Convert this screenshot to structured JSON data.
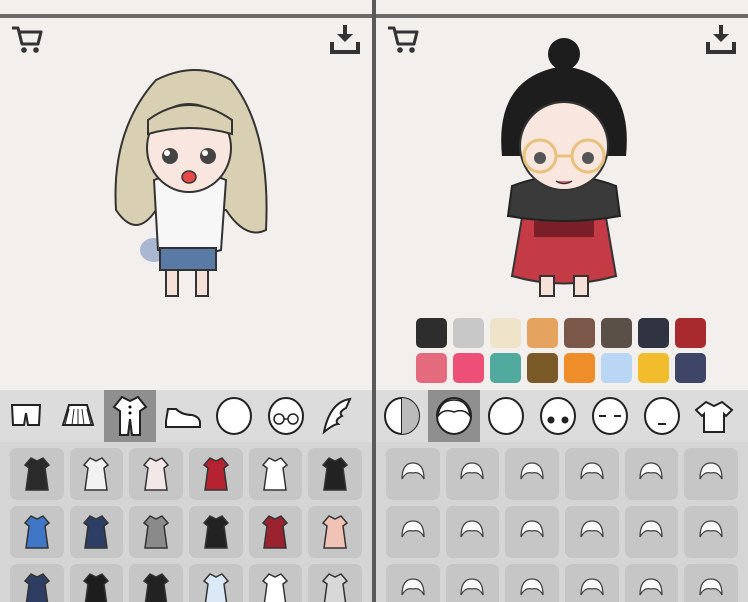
{
  "left_panel": {
    "tabs": [
      "shorts-icon",
      "skirt-icon",
      "jumpsuit-icon",
      "shoe-icon",
      "face-icon",
      "glasses-icon",
      "wing-icon"
    ],
    "selected_tab": 2,
    "items": [
      {
        "name": "black-dress-icon",
        "color": "#2a2a2a"
      },
      {
        "name": "white-dress-icon",
        "color": "#f2f2f2"
      },
      {
        "name": "pink-dress-icon",
        "color": "#f3e7e7"
      },
      {
        "name": "red-dress-icon",
        "color": "#b4232f"
      },
      {
        "name": "sailor-dress-icon",
        "color": "#ffffff"
      },
      {
        "name": "black-apron-dress-icon",
        "color": "#222222"
      },
      {
        "name": "blue-kimono-icon",
        "color": "#3f76c5"
      },
      {
        "name": "navy-tshirt-icon",
        "color": "#2e3d64"
      },
      {
        "name": "gray-apron-dress-icon",
        "color": "#8a8a8a"
      },
      {
        "name": "black-jumpsuit-icon",
        "color": "#222222"
      },
      {
        "name": "maroon-dress-icon",
        "color": "#9b2330"
      },
      {
        "name": "peach-coat-icon",
        "color": "#f1c2b6"
      },
      {
        "name": "navy-coat-icon",
        "color": "#2e3d64"
      },
      {
        "name": "black-white-dress-icon",
        "color": "#1d1d1d"
      },
      {
        "name": "black-offshoulder-icon",
        "color": "#222222"
      },
      {
        "name": "blue-print-dress-icon",
        "color": "#dbe8f5"
      },
      {
        "name": "white-dress2-icon",
        "color": "#ffffff"
      },
      {
        "name": "gray-coat-icon",
        "color": "#d8d8d8"
      }
    ]
  },
  "right_panel": {
    "palette": [
      "#2d2d2d",
      "#c8c8c8",
      "#efe3c9",
      "#e4a35e",
      "#7a5748",
      "#5b5048",
      "#2f3440",
      "#a82a2e",
      "#e46b7e",
      "#ec4f78",
      "#50a99c",
      "#7a5a26",
      "#ef8e28",
      "#b9d6f2",
      "#f2bc2c",
      "#3e4567"
    ],
    "tabs": [
      "half-face-icon",
      "hair-icon",
      "head-icon",
      "eyes-icon",
      "eyebrows-icon",
      "mouth-icon",
      "shirt-icon"
    ],
    "selected_tab": 1,
    "items": [
      {
        "name": "hair-style-1-icon"
      },
      {
        "name": "hair-style-2-icon"
      },
      {
        "name": "hair-style-3-icon"
      },
      {
        "name": "hair-style-4-icon"
      },
      {
        "name": "hair-style-5-icon"
      },
      {
        "name": "hair-style-6-icon"
      },
      {
        "name": "hair-style-7-icon"
      },
      {
        "name": "hair-style-8-icon"
      },
      {
        "name": "hair-style-9-icon"
      },
      {
        "name": "hair-style-10-icon"
      },
      {
        "name": "hair-style-11-icon"
      },
      {
        "name": "hair-style-12-icon"
      },
      {
        "name": "hair-style-13-icon"
      },
      {
        "name": "hair-style-14-icon"
      },
      {
        "name": "hair-style-15-icon"
      },
      {
        "name": "hair-style-16-icon"
      },
      {
        "name": "hair-style-17-icon"
      },
      {
        "name": "hair-style-18-icon"
      }
    ]
  }
}
